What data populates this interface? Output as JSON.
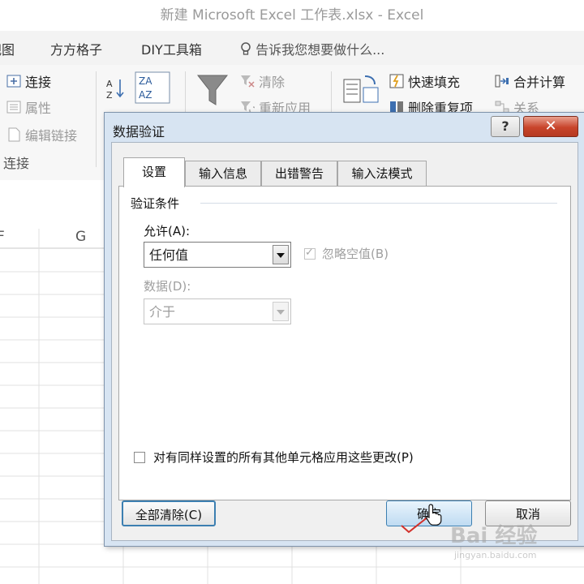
{
  "window": {
    "title": "新建 Microsoft Excel 工作表.xlsx - Excel"
  },
  "menubar": {
    "items": [
      "视图",
      "方方格子",
      "DIY工具箱"
    ],
    "tell_me": "告诉我您想要做什么..."
  },
  "ribbon": {
    "connections": {
      "connect": "连接",
      "properties": "属性",
      "edit_links": "编辑链接",
      "group": "连接"
    },
    "filter": {
      "clear": "清除",
      "reapply": "重新应用"
    },
    "tools": {
      "flash_fill": "快速填充",
      "remove_duplicates": "删除重复项",
      "consolidate": "合并计算",
      "relationships": "关系"
    }
  },
  "sheet": {
    "columns": [
      "F",
      "G"
    ]
  },
  "dialog": {
    "title": "数据验证",
    "help": "?",
    "close": "✕",
    "tabs": [
      "设置",
      "输入信息",
      "出错警告",
      "输入法模式"
    ],
    "active_tab": "设置",
    "section": "验证条件",
    "allow_label": "允许(A):",
    "allow_value": "任何值",
    "ignore_blank_label": "忽略空值(B)",
    "data_label": "数据(D):",
    "data_value": "介于",
    "apply_all_label": "对有同样设置的所有其他单元格应用这些更改(P)",
    "clear_all": "全部清除(C)",
    "ok": "确定",
    "cancel": "取消"
  },
  "watermark": {
    "brand": "Bai 经验",
    "url": "jingyan.baidu.com"
  },
  "colors": {
    "close_red": "#c8442b",
    "dialog_frame": "#d7e4f2",
    "focus_blue": "#3c7fb1"
  }
}
